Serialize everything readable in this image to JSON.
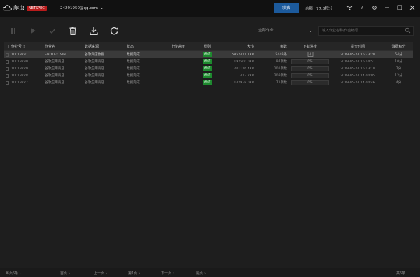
{
  "app": {
    "name": "爬虫",
    "badge": "NETSPEC",
    "account": "24291950@qq.com",
    "renew_label": "续费",
    "remaining_label": "余额",
    "remaining_value": "77.8积分"
  },
  "toolbar": {
    "task_type_select": "全部作业",
    "search_placeholder": "输入作业名称/作业编号"
  },
  "table": {
    "headers": {
      "id": "作业号",
      "name": "作业名",
      "source": "数据来源",
      "state": "状态",
      "upload": "上传进度",
      "rule": "规则",
      "size": "大小",
      "count": "条数",
      "progress": "下载进度",
      "time": "提交时间",
      "fee": "消费积分"
    },
    "rows": [
      {
        "id": "10018731",
        "name": "ENDTEXTSIN...",
        "source": "谷歌商店数据...",
        "state": "数据完成",
        "rule": "通过",
        "size": "5852411.1KB",
        "count": "5448条",
        "progress": "",
        "progress_value": 0,
        "time": "2019-05-24 16:23:20",
        "fee": "54分",
        "selected": true
      },
      {
        "id": "10018730",
        "name": "谷歌应用商店...",
        "source": "谷歌应用商店...",
        "state": "数据完成",
        "rule": "通过",
        "size": "192500.0KB",
        "count": "97条数",
        "progress": "0%",
        "progress_value": 0,
        "time": "2019-05-24 16:14:51",
        "fee": "10分",
        "selected": false
      },
      {
        "id": "10018729",
        "name": "谷歌应用商店...",
        "source": "谷歌应用商店...",
        "state": "数据完成",
        "rule": "通过",
        "size": "201116.4KB",
        "count": "101条数",
        "progress": "0%",
        "progress_value": 0,
        "time": "2019-05-24 16:13:10",
        "fee": "7分",
        "selected": false
      },
      {
        "id": "10018728",
        "name": "谷歌应用商店...",
        "source": "谷歌应用商店...",
        "state": "数据完成",
        "rule": "通过",
        "size": "413.2KB",
        "count": "208条数",
        "progress": "0%",
        "progress_value": 0,
        "time": "2019-05-24 14:40:05",
        "fee": "12分",
        "selected": false
      },
      {
        "id": "10018727",
        "name": "谷歌应用商店...",
        "source": "谷歌应用商店...",
        "state": "数据完成",
        "rule": "通过",
        "size": "142938.0KB",
        "count": "71条数",
        "progress": "0%",
        "progress_value": 0,
        "time": "2019-05-24 14:40:46",
        "fee": "4分",
        "selected": false
      }
    ]
  },
  "footer": {
    "per_page": "每页5条",
    "first": "首页",
    "prev": "上一页",
    "page": "第1页",
    "next": "下一页",
    "last": "尾页",
    "total": "共5条"
  },
  "colors": {
    "accent": "#1c5a9c",
    "badge": "#b81b1b",
    "pass": "#1d8a2e"
  }
}
